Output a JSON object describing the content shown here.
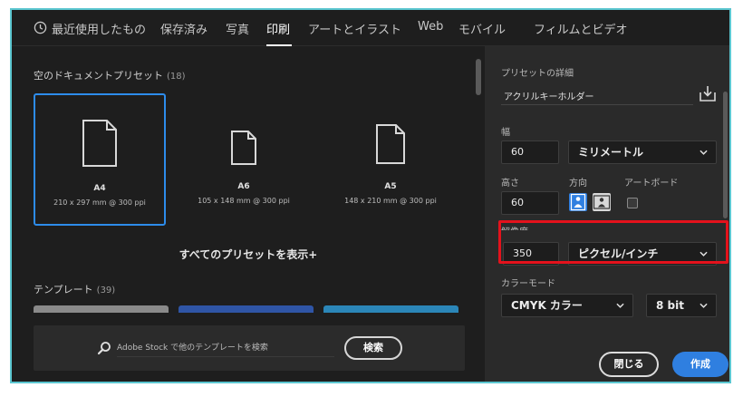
{
  "nav": {
    "items": [
      {
        "label": "最近使用したもの"
      },
      {
        "label": "保存済み"
      },
      {
        "label": "写真"
      },
      {
        "label": "印刷"
      },
      {
        "label": "アートとイラスト"
      },
      {
        "label": "Web"
      },
      {
        "label": "モバイル"
      },
      {
        "label": "フィルムとビデオ"
      }
    ],
    "active": "印刷",
    "recent_icon": "clock-icon"
  },
  "presets": {
    "title": "空のドキュメントプリセット",
    "count": "(18)",
    "items": [
      {
        "name": "A4",
        "size": "210 x 297 mm @ 300 ppi",
        "icon": "document-icon"
      },
      {
        "name": "A6",
        "size": "105 x 148 mm @ 300 ppi",
        "icon": "document-icon"
      },
      {
        "name": "A5",
        "size": "148 x 210 mm @ 300 ppi",
        "icon": "document-icon"
      }
    ],
    "show_all": "すべてのプリセットを表示+"
  },
  "templates": {
    "title": "テンプレート",
    "count": "(39)"
  },
  "stock": {
    "placeholder": "Adobe Stock で他のテンプレートを検索",
    "button": "検索",
    "icon": "search-icon"
  },
  "details": {
    "title": "プリセットの詳細",
    "name": "アクリルキーホルダー",
    "save_icon": "save-preset-icon",
    "width_label": "幅",
    "width_value": "60",
    "unit": "ミリメートル",
    "height_label": "高さ",
    "height_value": "60",
    "orientation_label": "方向",
    "artboard_label": "アートボード",
    "resolution_label": "解像度",
    "resolution_value": "350",
    "resolution_unit": "ピクセル/インチ",
    "color_mode_label": "カラーモード",
    "color_mode": "CMYK カラー",
    "bit_depth": "8 bit"
  },
  "actions": {
    "close": "閉じる",
    "create": "作成"
  },
  "colors": {
    "accent": "#2f7fe0",
    "selection": "#2d8ceb",
    "highlight": "#e4121c",
    "frame": "#5bc6d0"
  }
}
